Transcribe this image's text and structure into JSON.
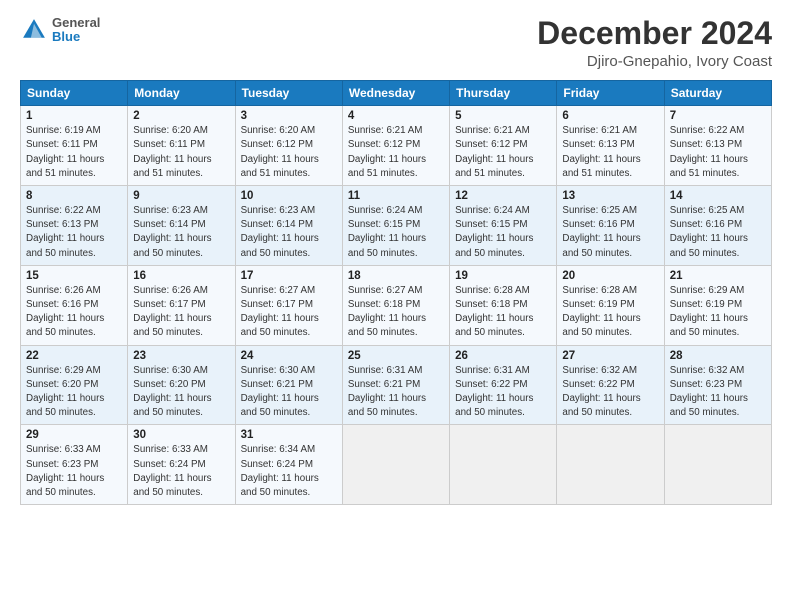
{
  "logo": {
    "text_general": "General",
    "text_blue": "Blue"
  },
  "title": "December 2024",
  "subtitle": "Djiro-Gnepahio, Ivory Coast",
  "days_header": [
    "Sunday",
    "Monday",
    "Tuesday",
    "Wednesday",
    "Thursday",
    "Friday",
    "Saturday"
  ],
  "weeks": [
    [
      {
        "day": "1",
        "info": "Sunrise: 6:19 AM\nSunset: 6:11 PM\nDaylight: 11 hours\nand 51 minutes."
      },
      {
        "day": "2",
        "info": "Sunrise: 6:20 AM\nSunset: 6:11 PM\nDaylight: 11 hours\nand 51 minutes."
      },
      {
        "day": "3",
        "info": "Sunrise: 6:20 AM\nSunset: 6:12 PM\nDaylight: 11 hours\nand 51 minutes."
      },
      {
        "day": "4",
        "info": "Sunrise: 6:21 AM\nSunset: 6:12 PM\nDaylight: 11 hours\nand 51 minutes."
      },
      {
        "day": "5",
        "info": "Sunrise: 6:21 AM\nSunset: 6:12 PM\nDaylight: 11 hours\nand 51 minutes."
      },
      {
        "day": "6",
        "info": "Sunrise: 6:21 AM\nSunset: 6:13 PM\nDaylight: 11 hours\nand 51 minutes."
      },
      {
        "day": "7",
        "info": "Sunrise: 6:22 AM\nSunset: 6:13 PM\nDaylight: 11 hours\nand 51 minutes."
      }
    ],
    [
      {
        "day": "8",
        "info": "Sunrise: 6:22 AM\nSunset: 6:13 PM\nDaylight: 11 hours\nand 50 minutes."
      },
      {
        "day": "9",
        "info": "Sunrise: 6:23 AM\nSunset: 6:14 PM\nDaylight: 11 hours\nand 50 minutes."
      },
      {
        "day": "10",
        "info": "Sunrise: 6:23 AM\nSunset: 6:14 PM\nDaylight: 11 hours\nand 50 minutes."
      },
      {
        "day": "11",
        "info": "Sunrise: 6:24 AM\nSunset: 6:15 PM\nDaylight: 11 hours\nand 50 minutes."
      },
      {
        "day": "12",
        "info": "Sunrise: 6:24 AM\nSunset: 6:15 PM\nDaylight: 11 hours\nand 50 minutes."
      },
      {
        "day": "13",
        "info": "Sunrise: 6:25 AM\nSunset: 6:16 PM\nDaylight: 11 hours\nand 50 minutes."
      },
      {
        "day": "14",
        "info": "Sunrise: 6:25 AM\nSunset: 6:16 PM\nDaylight: 11 hours\nand 50 minutes."
      }
    ],
    [
      {
        "day": "15",
        "info": "Sunrise: 6:26 AM\nSunset: 6:16 PM\nDaylight: 11 hours\nand 50 minutes."
      },
      {
        "day": "16",
        "info": "Sunrise: 6:26 AM\nSunset: 6:17 PM\nDaylight: 11 hours\nand 50 minutes."
      },
      {
        "day": "17",
        "info": "Sunrise: 6:27 AM\nSunset: 6:17 PM\nDaylight: 11 hours\nand 50 minutes."
      },
      {
        "day": "18",
        "info": "Sunrise: 6:27 AM\nSunset: 6:18 PM\nDaylight: 11 hours\nand 50 minutes."
      },
      {
        "day": "19",
        "info": "Sunrise: 6:28 AM\nSunset: 6:18 PM\nDaylight: 11 hours\nand 50 minutes."
      },
      {
        "day": "20",
        "info": "Sunrise: 6:28 AM\nSunset: 6:19 PM\nDaylight: 11 hours\nand 50 minutes."
      },
      {
        "day": "21",
        "info": "Sunrise: 6:29 AM\nSunset: 6:19 PM\nDaylight: 11 hours\nand 50 minutes."
      }
    ],
    [
      {
        "day": "22",
        "info": "Sunrise: 6:29 AM\nSunset: 6:20 PM\nDaylight: 11 hours\nand 50 minutes."
      },
      {
        "day": "23",
        "info": "Sunrise: 6:30 AM\nSunset: 6:20 PM\nDaylight: 11 hours\nand 50 minutes."
      },
      {
        "day": "24",
        "info": "Sunrise: 6:30 AM\nSunset: 6:21 PM\nDaylight: 11 hours\nand 50 minutes."
      },
      {
        "day": "25",
        "info": "Sunrise: 6:31 AM\nSunset: 6:21 PM\nDaylight: 11 hours\nand 50 minutes."
      },
      {
        "day": "26",
        "info": "Sunrise: 6:31 AM\nSunset: 6:22 PM\nDaylight: 11 hours\nand 50 minutes."
      },
      {
        "day": "27",
        "info": "Sunrise: 6:32 AM\nSunset: 6:22 PM\nDaylight: 11 hours\nand 50 minutes."
      },
      {
        "day": "28",
        "info": "Sunrise: 6:32 AM\nSunset: 6:23 PM\nDaylight: 11 hours\nand 50 minutes."
      }
    ],
    [
      {
        "day": "29",
        "info": "Sunrise: 6:33 AM\nSunset: 6:23 PM\nDaylight: 11 hours\nand 50 minutes."
      },
      {
        "day": "30",
        "info": "Sunrise: 6:33 AM\nSunset: 6:24 PM\nDaylight: 11 hours\nand 50 minutes."
      },
      {
        "day": "31",
        "info": "Sunrise: 6:34 AM\nSunset: 6:24 PM\nDaylight: 11 hours\nand 50 minutes."
      },
      {
        "day": "",
        "info": ""
      },
      {
        "day": "",
        "info": ""
      },
      {
        "day": "",
        "info": ""
      },
      {
        "day": "",
        "info": ""
      }
    ]
  ]
}
